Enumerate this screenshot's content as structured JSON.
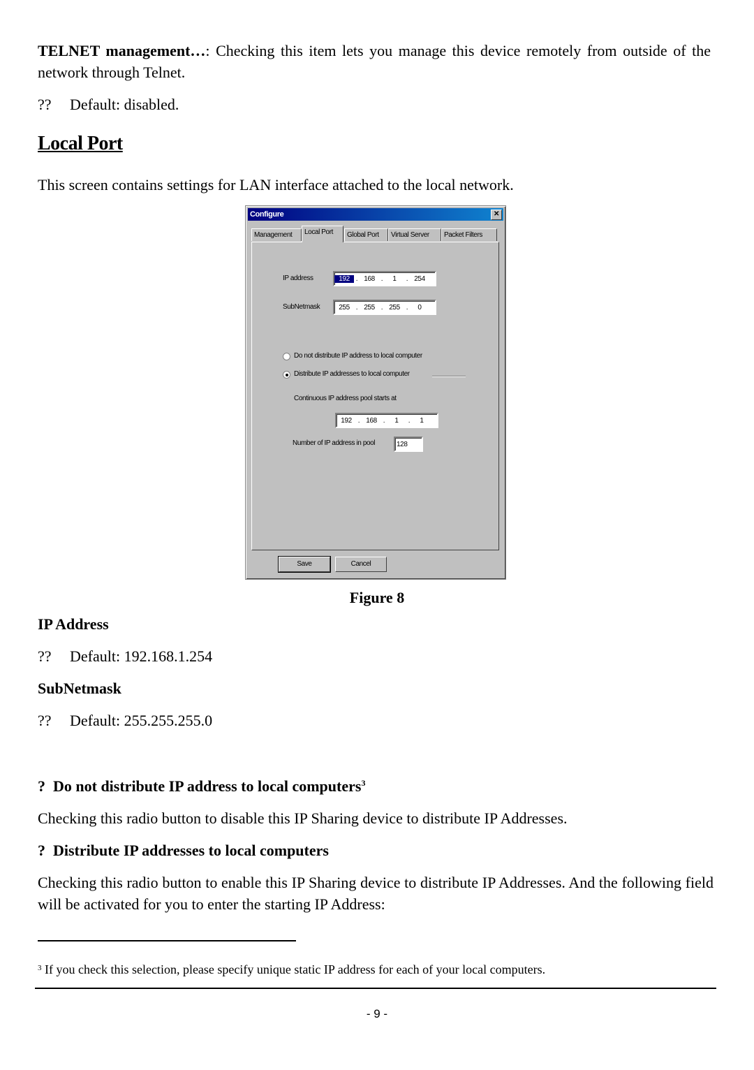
{
  "telnet": {
    "term": "TELNET management…",
    "text": ": Checking this item lets you manage this device remotely from outside of the network through Telnet.",
    "default_bullet": "??",
    "default": "Default: disabled."
  },
  "section": {
    "title": "Local Port",
    "intro": "This screen contains settings for LAN interface attached to the local network."
  },
  "dialog": {
    "title": "Configure",
    "close_glyph": "✕",
    "tabs": [
      {
        "label": "Management",
        "active": false
      },
      {
        "label": "Local Port",
        "active": true
      },
      {
        "label": "Global Port",
        "active": false
      },
      {
        "label": "Virtual Server",
        "active": false
      },
      {
        "label": "Packet Filters",
        "active": false
      }
    ],
    "ip_address": {
      "label": "IP address",
      "octets": [
        "192",
        "168",
        "1",
        "254"
      ]
    },
    "subnet_mask": {
      "label": "SubNetmask",
      "octets": [
        "255",
        "255",
        "255",
        "0"
      ]
    },
    "radio_no_distribute": {
      "label": "Do not distribute IP address to local computer",
      "checked": false
    },
    "radio_distribute": {
      "label": "Distribute IP addresses to local computer",
      "checked": true
    },
    "pool_start": {
      "label": "Continuous IP address pool starts at",
      "octets": [
        "192",
        "168",
        "1",
        "1"
      ]
    },
    "pool_count": {
      "label": "Number of IP address in pool",
      "value": "128"
    },
    "buttons": {
      "save": "Save",
      "cancel": "Cancel"
    }
  },
  "figure_caption": "Figure 8",
  "ip_address_section": {
    "title": "IP Address",
    "bullet": "??",
    "default": "Default: 192.168.1.254"
  },
  "subnet_section": {
    "title": "SubNetmask",
    "bullet": "??",
    "default": "Default:  255.255.255.0"
  },
  "no_distribute_section": {
    "bullet": "?",
    "title": "Do not distribute IP address to local computers",
    "footnote_ref": "3",
    "text": "Checking this radio button to disable this IP Sharing device to distribute IP Addresses."
  },
  "distribute_section": {
    "bullet": "?",
    "title": "Distribute IP addresses to local computers",
    "text": "Checking this radio button to enable this IP Sharing device to distribute IP Addresses. And the following field will be activated for you to enter the starting IP Address:"
  },
  "footnote": {
    "number": "3",
    "text": "If you check this selection, please specify unique static IP address for each of your local computers."
  },
  "page_number": "- 9 -"
}
